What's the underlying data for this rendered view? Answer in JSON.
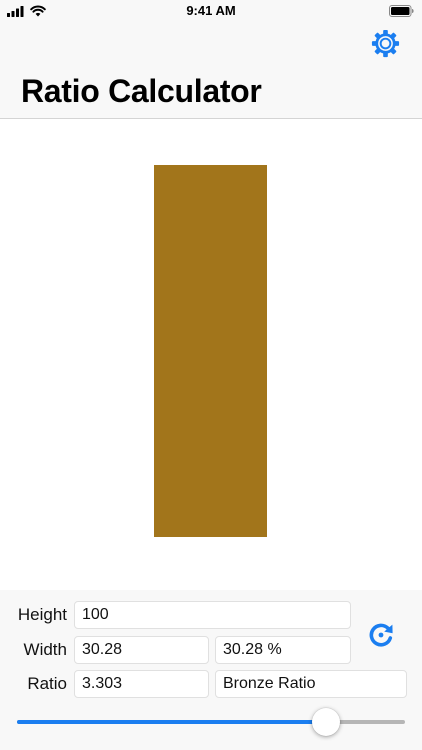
{
  "status_bar": {
    "time": "9:41 AM",
    "signal_icon": "cellular-signal-icon",
    "wifi_icon": "wifi-icon",
    "battery_icon": "battery-icon"
  },
  "header": {
    "title": "Ratio Calculator",
    "settings_icon": "gear-icon"
  },
  "preview": {
    "fill_color": "#a2751b"
  },
  "form": {
    "height": {
      "label": "Height",
      "value": "100"
    },
    "width": {
      "label": "Width",
      "value": "30.28",
      "percent": "30.28 %"
    },
    "ratio": {
      "label": "Ratio",
      "value": "3.303",
      "name": "Bronze Ratio"
    },
    "rotate_icon": "rotate-icon"
  },
  "slider": {
    "value_fraction": 0.797,
    "min_track_color": "#1b7ef0",
    "max_track_color": "#b6b6b6"
  },
  "colors": {
    "accent": "#1b7ef0",
    "bronze": "#a2751b"
  }
}
